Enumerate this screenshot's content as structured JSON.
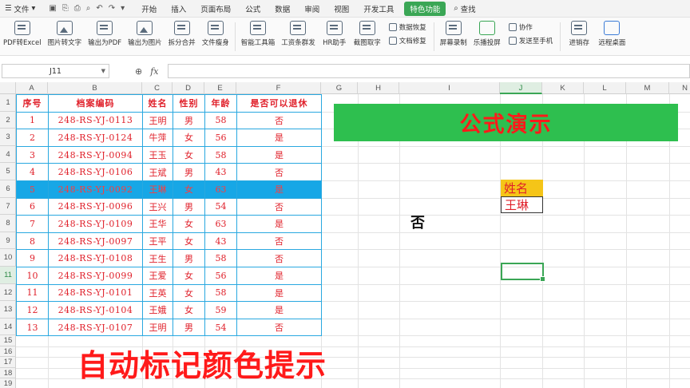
{
  "menu": {
    "file": "文件",
    "tabs": [
      "开始",
      "插入",
      "页面布局",
      "公式",
      "数据",
      "审阅",
      "视图",
      "开发工具"
    ],
    "special": "特色功能",
    "search": "查找"
  },
  "ribbon": {
    "buttons": [
      "PDF转Excel",
      "图片转文字",
      "输出为PDF",
      "输出为图片",
      "拆分合并",
      "文件瘦身",
      "智能工具箱",
      "工资条群发",
      "HR助手",
      "截图取字"
    ],
    "stack1": [
      "数据恢复",
      "文档修复"
    ],
    "buttons2": [
      "屏幕录制",
      "乐播投屏"
    ],
    "stack2": [
      "协作",
      "发送至手机"
    ],
    "buttons3": [
      "进销存",
      "远程桌面"
    ]
  },
  "formula_bar": {
    "cell_ref": "J11",
    "fx": "fx",
    "value": ""
  },
  "columns": [
    "A",
    "B",
    "C",
    "D",
    "E",
    "F",
    "G",
    "H",
    "I",
    "J",
    "K",
    "L",
    "M",
    "N"
  ],
  "selected_column": "J",
  "rows": [
    "1",
    "2",
    "3",
    "4",
    "5",
    "6",
    "7",
    "8",
    "9",
    "10",
    "11",
    "12",
    "13",
    "14",
    "15",
    "16",
    "17",
    "18",
    "19"
  ],
  "selected_row": "11",
  "table": {
    "headers": [
      "序号",
      "档案编码",
      "姓名",
      "性别",
      "年龄",
      "是否可以退休"
    ],
    "rows": [
      [
        "1",
        "248-RS-YJ-0113",
        "王明",
        "男",
        "58",
        "否"
      ],
      [
        "2",
        "248-RS-YJ-0124",
        "牛萍",
        "女",
        "56",
        "是"
      ],
      [
        "3",
        "248-RS-YJ-0094",
        "王玉",
        "女",
        "58",
        "是"
      ],
      [
        "4",
        "248-RS-YJ-0106",
        "王斌",
        "男",
        "43",
        "否"
      ],
      [
        "5",
        "248-RS-YJ-0092",
        "王琳",
        "女",
        "63",
        "是"
      ],
      [
        "6",
        "248-RS-YJ-0096",
        "王兴",
        "男",
        "54",
        "否"
      ],
      [
        "7",
        "248-RS-YJ-0109",
        "王华",
        "女",
        "63",
        "是"
      ],
      [
        "8",
        "248-RS-YJ-0097",
        "王平",
        "女",
        "43",
        "否"
      ],
      [
        "9",
        "248-RS-YJ-0108",
        "王生",
        "男",
        "58",
        "否"
      ],
      [
        "10",
        "248-RS-YJ-0099",
        "王爱",
        "女",
        "56",
        "是"
      ],
      [
        "11",
        "248-RS-YJ-0101",
        "王英",
        "女",
        "58",
        "是"
      ],
      [
        "12",
        "248-RS-YJ-0104",
        "王娥",
        "女",
        "59",
        "是"
      ],
      [
        "13",
        "248-RS-YJ-0107",
        "王明",
        "男",
        "54",
        "否"
      ]
    ],
    "highlight_row_index": 4
  },
  "banner": "公式演示",
  "lookup": {
    "header": "姓名",
    "value": "王琳",
    "result": "否"
  },
  "bottom_title": "自动标记颜色提示",
  "colors": {
    "accent_green": "#3aa655",
    "banner_green": "#2ebf4f",
    "highlight_blue": "#17a7e6",
    "text_red": "#e0202a",
    "header_yellow": "#f5c518"
  }
}
